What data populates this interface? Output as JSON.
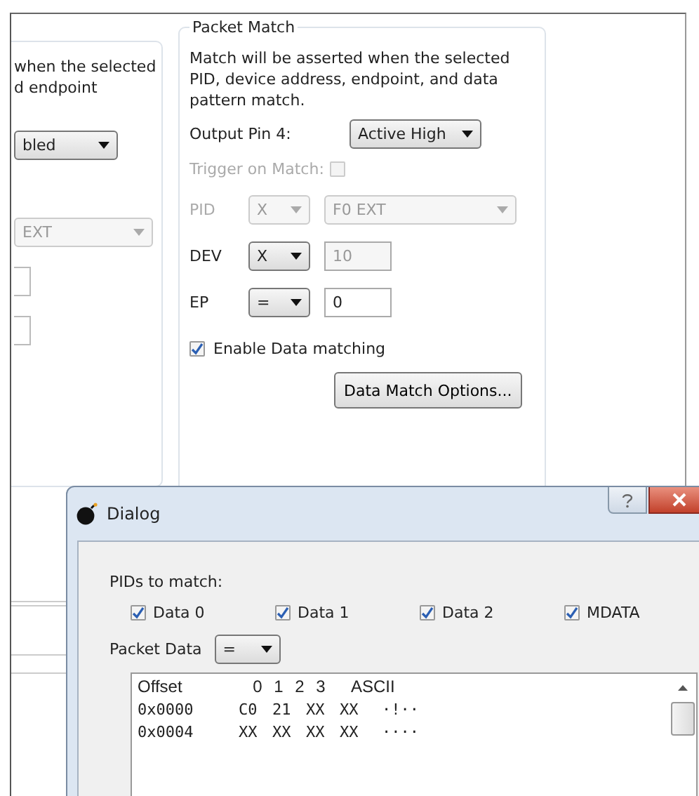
{
  "left_panel": {
    "description_lines": [
      "when the selected",
      "d endpoint"
    ],
    "mode_select": {
      "value": "bled"
    },
    "pid_select": {
      "value": "EXT",
      "disabled": true
    }
  },
  "packet_match": {
    "title": "Packet Match",
    "description": "Match will be asserted when the selected PID, device address, endpoint, and data pattern match.",
    "output_pin": {
      "label": "Output Pin 4:",
      "value": "Active High"
    },
    "trigger": {
      "label": "Trigger on Match:",
      "checked": false,
      "disabled": true
    },
    "rows": [
      {
        "label": "PID",
        "operator": {
          "value": "X",
          "disabled": true
        },
        "value": {
          "kind": "select",
          "text": "F0 EXT",
          "disabled": true
        }
      },
      {
        "label": "DEV",
        "operator": {
          "value": "X",
          "disabled": false
        },
        "value": {
          "kind": "input",
          "text": "10",
          "disabled": true
        }
      },
      {
        "label": "EP",
        "operator": {
          "value": "=",
          "disabled": false
        },
        "value": {
          "kind": "input",
          "text": "0",
          "disabled": false
        }
      }
    ],
    "enable_data": {
      "label": "Enable Data matching",
      "checked": true
    },
    "options_button": "Data Match Options..."
  },
  "dialog": {
    "title": "Dialog",
    "pids_label": "PIDs to match:",
    "pids": [
      {
        "label": "Data 0",
        "checked": true
      },
      {
        "label": "Data 1",
        "checked": true
      },
      {
        "label": "Data 2",
        "checked": true
      },
      {
        "label": "MDATA",
        "checked": true
      }
    ],
    "packet_data": {
      "label": "Packet Data",
      "operator": "="
    },
    "table": {
      "columns": [
        "Offset",
        "0",
        "1",
        "2",
        "3",
        "ASCII"
      ],
      "rows": [
        {
          "offset": "0x0000",
          "bytes": [
            "C0",
            "21",
            "XX",
            "XX"
          ],
          "ascii": "·!··"
        },
        {
          "offset": "0x0004",
          "bytes": [
            "XX",
            "XX",
            "XX",
            "XX"
          ],
          "ascii": "····"
        }
      ]
    }
  }
}
